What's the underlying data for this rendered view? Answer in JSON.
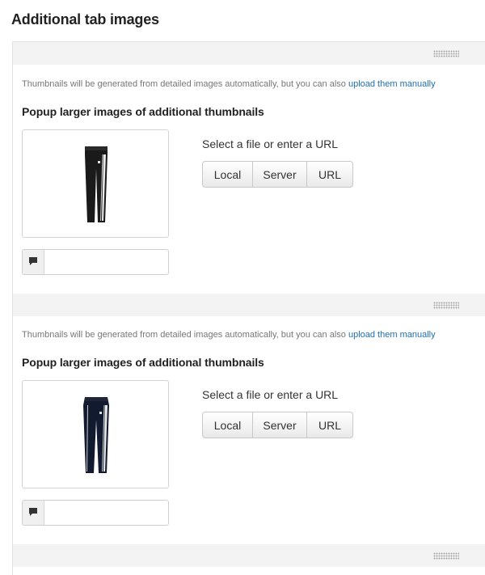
{
  "heading": "Additional tab images",
  "sections": [
    {
      "note_text": "Thumbnails will be generated from detailed images automatically, but you can also ",
      "note_link": "upload them manually",
      "subheading": "Popup larger images of additional thumbnails",
      "select_label": "Select a file or enter a URL",
      "buttons": {
        "local": "Local",
        "server": "Server",
        "url": "URL"
      },
      "alt_text_value": "",
      "alt_icon": "comment-icon",
      "image": "track-pants-thumbnail"
    },
    {
      "note_text": "Thumbnails will be generated from detailed images automatically, but you can also ",
      "note_link": "upload them manually",
      "subheading": "Popup larger images of additional thumbnails",
      "select_label": "Select a file or enter a URL",
      "buttons": {
        "local": "Local",
        "server": "Server",
        "url": "URL"
      },
      "alt_text_value": "",
      "alt_icon": "comment-icon",
      "image": "track-pants-thumbnail"
    }
  ],
  "colors": {
    "link": "#1c6fb5",
    "strip": "#f3f3f3",
    "border": "#d4d4d4"
  }
}
